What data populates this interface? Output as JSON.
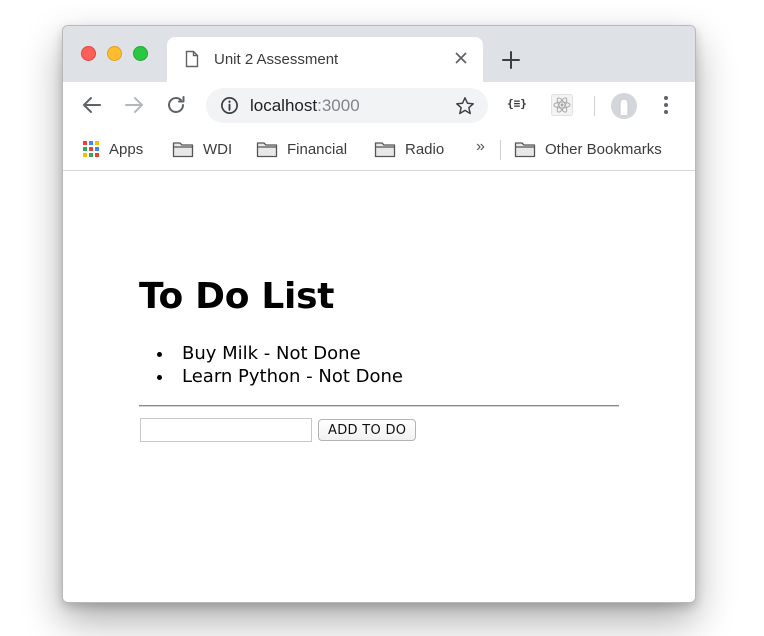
{
  "tab": {
    "title": "Unit 2 Assessment"
  },
  "omnibox": {
    "host": "localhost",
    "port": ":3000"
  },
  "extensions": {
    "json_viewer": "{≡}"
  },
  "bookmarks": {
    "apps": "Apps",
    "items": [
      "WDI",
      "Financial",
      "Radio"
    ],
    "overflow": "»",
    "other": "Other Bookmarks"
  },
  "page": {
    "title": "To Do List",
    "todos": [
      "Buy Milk - Not Done",
      "Learn Python - Not Done"
    ],
    "input_value": "",
    "add_button": "ADD TO DO"
  },
  "colors": {
    "traffic_red": "#fe5f57",
    "traffic_yellow": "#febc2e",
    "traffic_green": "#28c840",
    "tabstrip": "#dee1e6",
    "omnibox_bg": "#f1f3f4"
  },
  "icons": [
    "page-icon",
    "close-icon",
    "plus-icon",
    "back-arrow-icon",
    "forward-arrow-icon",
    "reload-icon",
    "info-icon",
    "star-icon",
    "react-icon",
    "menu-dots-icon",
    "apps-grid-icon",
    "folder-icon"
  ]
}
